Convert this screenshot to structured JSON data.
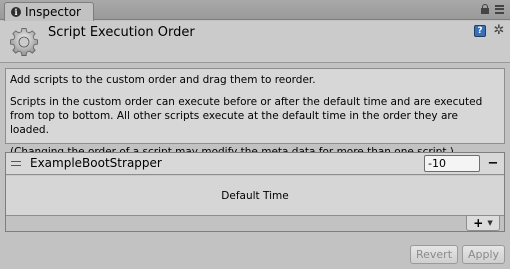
{
  "tab": {
    "label": "Inspector",
    "info_glyph": "i"
  },
  "header": {
    "title": "Script Execution Order"
  },
  "description": {
    "line1": "Add scripts to the custom order and drag them to reorder.",
    "line2": "Scripts in the custom order can execute before or after the default time and are executed from top to bottom. All other scripts execute at the default time in the order they are loaded.",
    "line3": "(Changing the order of a script may modify the meta data for more than one script.)"
  },
  "list": {
    "items": [
      {
        "name": "ExampleBootStrapper",
        "order": "-10"
      }
    ],
    "default_time_label": "Default Time"
  },
  "buttons": {
    "revert": "Revert",
    "apply": "Apply",
    "remove": "−",
    "add": "+"
  },
  "icons": {
    "tab": "info-icon",
    "header": "script-gear-icon",
    "help": "help-book-icon",
    "settings": "settings-gear-icon",
    "lock": "lock-icon",
    "menu": "menu-icon"
  }
}
